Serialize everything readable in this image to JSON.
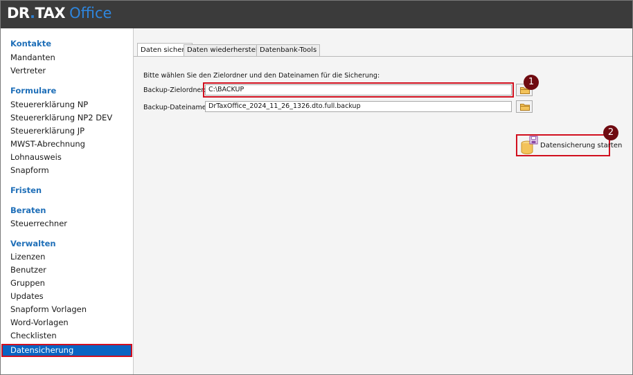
{
  "app": {
    "logo_dr": "DR",
    "logo_dot": ".",
    "logo_tax": "TAX",
    "logo_office": "Office"
  },
  "sidebar": {
    "sections": [
      {
        "heading": "Kontakte",
        "items": [
          "Mandanten",
          "Vertreter"
        ]
      },
      {
        "heading": "Formulare",
        "items": [
          "Steuererklärung NP",
          "Steuererklärung NP2 DEV",
          "Steuererklärung JP",
          "MWST-Abrechnung",
          "Lohnausweis",
          "Snapform"
        ]
      },
      {
        "heading": "Fristen",
        "items": []
      },
      {
        "heading": "Beraten",
        "items": [
          "Steuerrechner"
        ]
      },
      {
        "heading": "Verwalten",
        "items": [
          "Lizenzen",
          "Benutzer",
          "Gruppen",
          "Updates",
          "Snapform Vorlagen",
          "Word-Vorlagen",
          "Checklisten",
          "Datensicherung"
        ]
      }
    ],
    "active_item": "Datensicherung"
  },
  "tabs": [
    "Daten sichern",
    "Daten wiederherstellen",
    "Datenbank-Tools"
  ],
  "active_tab": "Daten sichern",
  "form": {
    "instruction": "Bitte wählen Sie den Zielordner und den Dateinamen für die Sicherung:",
    "folder_label": "Backup-Zielordner:",
    "folder_value": "C:\\BACKUP",
    "file_label": "Backup-Dateiname:",
    "file_value": "DrTaxOffice_2024_11_26_1326.dto.full.backup"
  },
  "start_button": {
    "label": "Datensicherung starten",
    "icon": "database-save-icon"
  },
  "annotations": {
    "badge_1": "1",
    "badge_2": "2"
  },
  "colors": {
    "accent": "#1f6fb8",
    "highlight": "#d10f1e",
    "active_bg": "#0a64c2",
    "badge": "#6f0b11",
    "topbar": "#3b3b3b"
  }
}
